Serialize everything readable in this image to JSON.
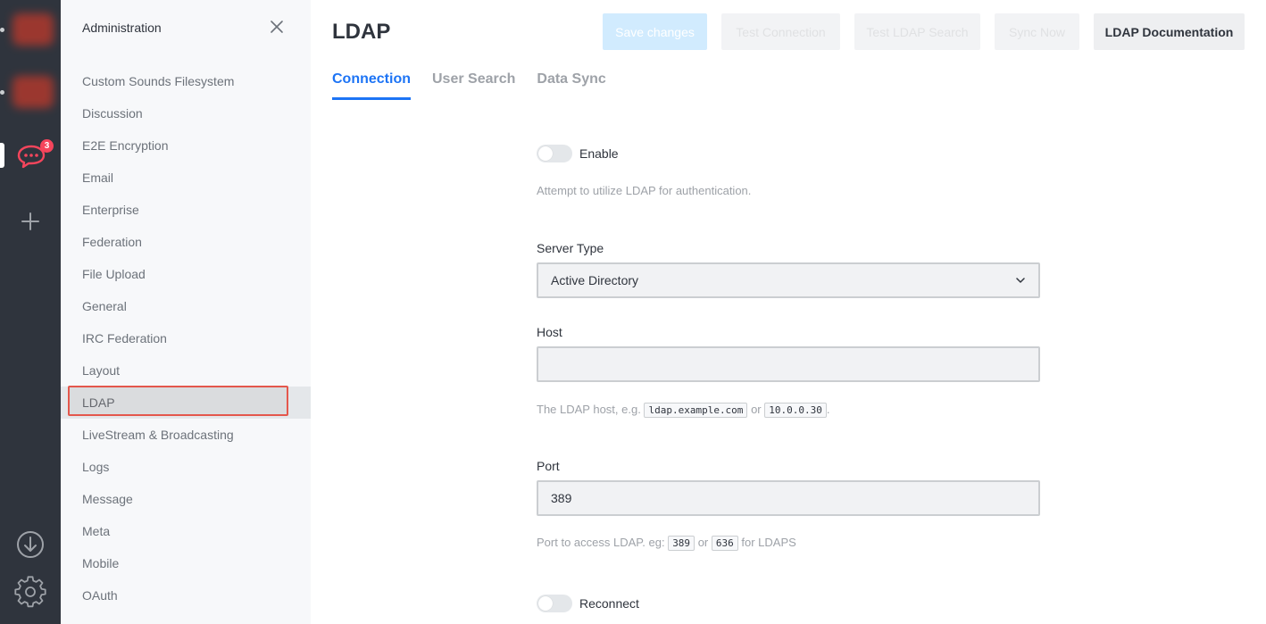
{
  "rail": {
    "badge_count": "3"
  },
  "sidebar": {
    "title": "Administration",
    "items": [
      {
        "label": "Custom Sounds Filesystem"
      },
      {
        "label": "Discussion"
      },
      {
        "label": "E2E Encryption"
      },
      {
        "label": "Email"
      },
      {
        "label": "Enterprise"
      },
      {
        "label": "Federation"
      },
      {
        "label": "File Upload"
      },
      {
        "label": "General"
      },
      {
        "label": "IRC Federation"
      },
      {
        "label": "Layout"
      },
      {
        "label": "LDAP",
        "active": true
      },
      {
        "label": "LiveStream & Broadcasting"
      },
      {
        "label": "Logs"
      },
      {
        "label": "Message"
      },
      {
        "label": "Meta"
      },
      {
        "label": "Mobile"
      },
      {
        "label": "OAuth"
      }
    ]
  },
  "header": {
    "title": "LDAP",
    "buttons": {
      "save": "Save changes",
      "test_connection": "Test Connection",
      "test_search": "Test LDAP Search",
      "sync": "Sync Now",
      "docs": "LDAP Documentation"
    }
  },
  "tabs": [
    {
      "label": "Connection",
      "active": true
    },
    {
      "label": "User Search"
    },
    {
      "label": "Data Sync"
    }
  ],
  "form": {
    "enable": {
      "label": "Enable",
      "checked": false,
      "hint": "Attempt to utilize LDAP for authentication."
    },
    "server_type": {
      "label": "Server Type",
      "value": "Active Directory"
    },
    "host": {
      "label": "Host",
      "value": "",
      "hint_prefix": "The LDAP host, e.g.",
      "hint_code1": "ldap.example.com",
      "hint_or": "or",
      "hint_code2": "10.0.0.30",
      "hint_suffix": "."
    },
    "port": {
      "label": "Port",
      "value": "389",
      "hint_prefix": "Port to access LDAP. eg:",
      "hint_code1": "389",
      "hint_or": "or",
      "hint_code2": "636",
      "hint_suffix": "for LDAPS"
    },
    "reconnect": {
      "label": "Reconnect",
      "checked": false
    }
  },
  "colors": {
    "accent": "#1d74f5",
    "highlight": "#e4574c",
    "badge": "#f5455c"
  }
}
